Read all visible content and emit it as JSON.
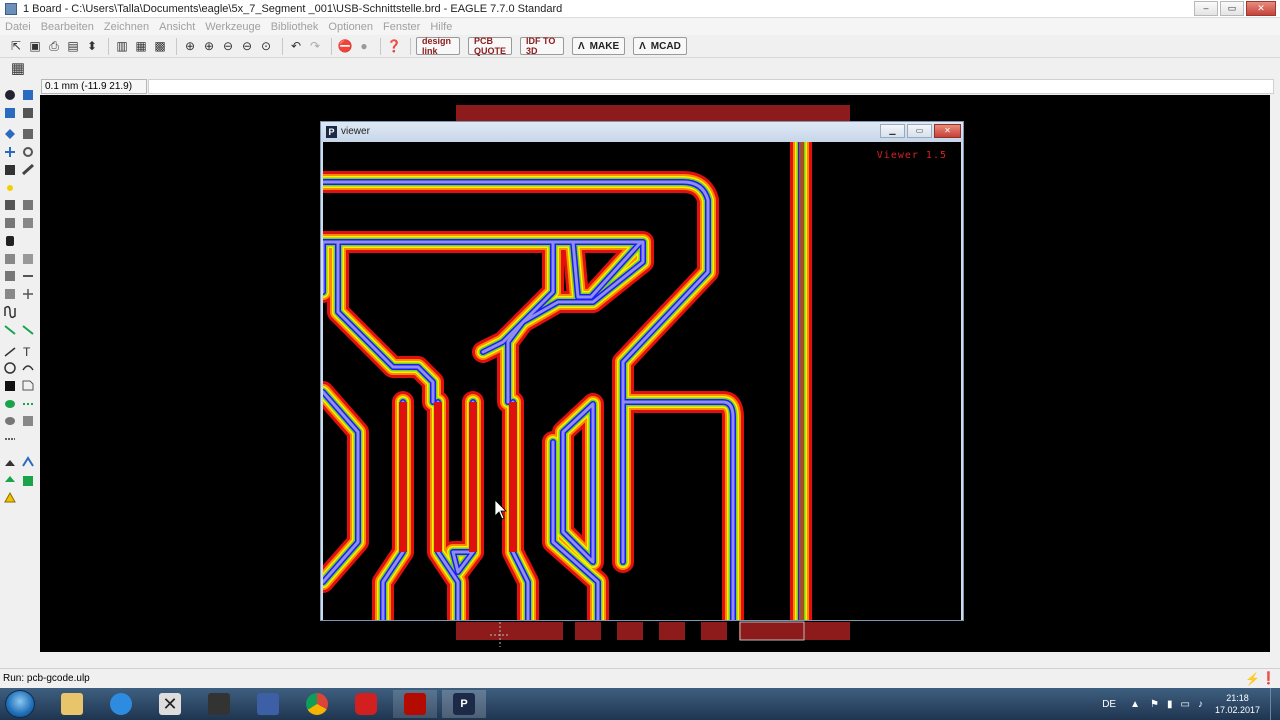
{
  "window": {
    "title": "1 Board - C:\\Users\\Talla\\Documents\\eagle\\5x_7_Segment _001\\USB-Schnittstelle.brd - EAGLE 7.7.0 Standard",
    "controls": {
      "minimize": "‒",
      "maximize": "▭",
      "close": "✕"
    }
  },
  "menu": [
    "Datei",
    "Bearbeiten",
    "Zeichnen",
    "Ansicht",
    "Werkzeuge",
    "Bibliothek",
    "Optionen",
    "Fenster",
    "Hilfe"
  ],
  "toolbar": {
    "icons": [
      "open-icon",
      "save-icon",
      "print-icon",
      "cam-icon",
      "ratsnest-icon",
      "layers-icon",
      "grid-icon",
      "board-icon",
      "zoom-fit-icon",
      "zoom-in-icon",
      "zoom-out-icon",
      "zoom-select-icon",
      "zoom-redraw-icon",
      "undo-icon",
      "redo-icon",
      "stop-icon",
      "go-icon",
      "help-icon"
    ],
    "design_link": "design link",
    "pcb_quote": "PCB QUOTE",
    "idf_to_3d": "IDF TO 3D",
    "make": "MAKE",
    "mcad": "MCAD"
  },
  "coordinate": "0.1 mm (-11.9 21.9)",
  "status": "Run: pcb-gcode.ulp",
  "viewer": {
    "title": "viewer",
    "label": "Viewer 1.5",
    "controls": {
      "minimize": "▁",
      "maximize": "▭",
      "close": "✕"
    }
  },
  "taskbar": {
    "apps": [
      "windows-explorer",
      "internet-explorer",
      "x-app",
      "eagle",
      "save-disk",
      "chrome",
      "acrobat-reader",
      "adobe-acrobat",
      "pcb-viewer"
    ],
    "language": "DE",
    "time": "21:18",
    "date": "17.02.2017"
  },
  "colors": {
    "canvas": "#000000",
    "pad": "#8e1b1b",
    "trace_red": "#e01010",
    "trace_orange": "#ff8a00",
    "trace_yellow": "#ffee00",
    "trace_green": "#7ad21a",
    "trace_blue": "#1a1aff",
    "trace_lavender": "#8f8fe8",
    "viewer_label": "#d82222"
  }
}
